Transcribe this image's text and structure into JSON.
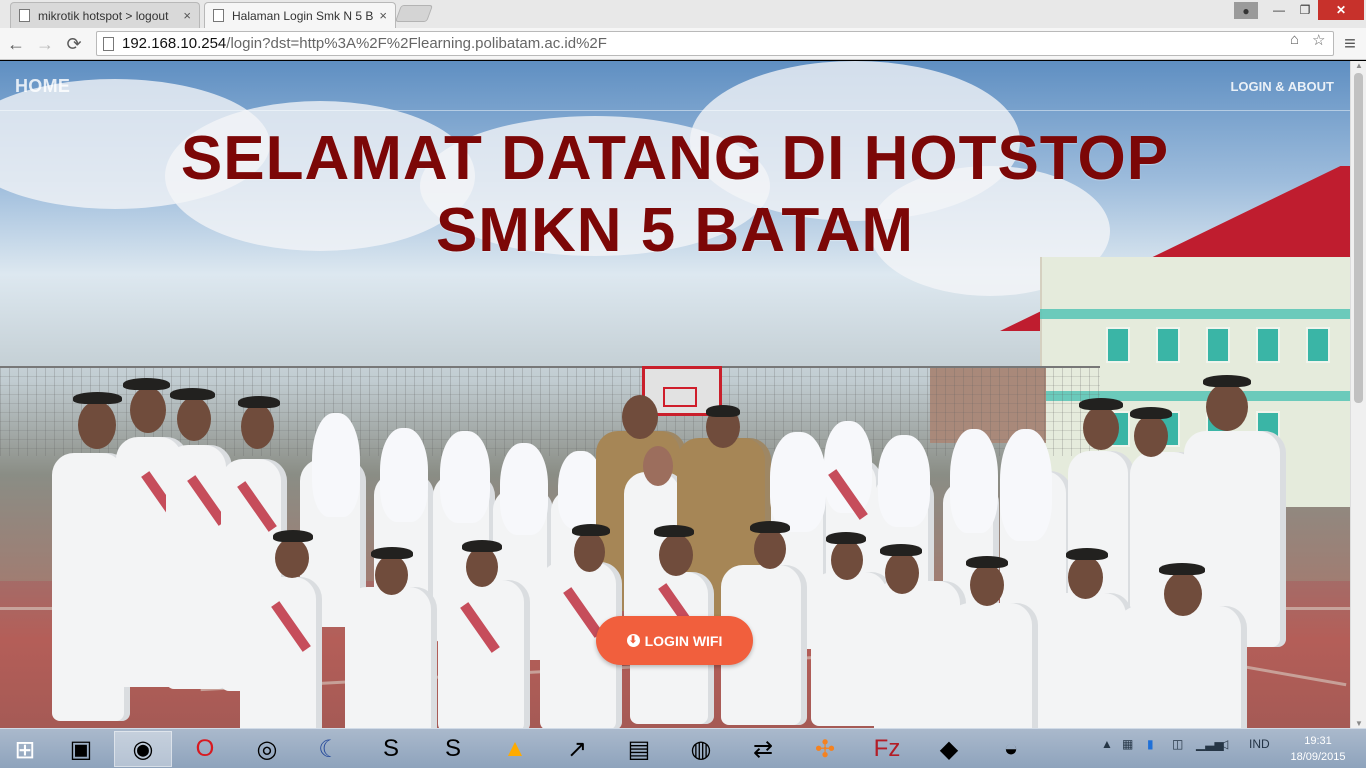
{
  "browser": {
    "tabs": [
      {
        "title": "mikrotik hotspot > logout"
      },
      {
        "title": "Halaman Login Smk N 5 B"
      }
    ],
    "address": {
      "host": "192.168.10.254",
      "path": "/login?dst=http%3A%2F%2Flearning.polibatam.ac.id%2F"
    }
  },
  "window": {
    "minimize": "—",
    "maximize": "❐",
    "close": "✕"
  },
  "page": {
    "nav": {
      "home": "HOME",
      "login_about": "LOGIN & ABOUT"
    },
    "heading": {
      "line1": "SELAMAT DATANG DI HOTSTOP",
      "line2": "SMKN 5 BATAM"
    },
    "login_button": "LOGIN WIFI"
  },
  "taskbar": {
    "language": "IND",
    "time": "19:31",
    "date": "18/09/2015"
  },
  "icons": {
    "close": "×",
    "person": "●",
    "back": "←",
    "forward": "→",
    "reload": "⟳",
    "translate": "⌂",
    "star": "☆",
    "menu": "≡",
    "download": "⬇",
    "scroll_up": "▲",
    "scroll_down": "▼",
    "start": "⊞",
    "folder": "▣",
    "chrome": "◉",
    "opera": "O",
    "globe": "◎",
    "moon": "☾",
    "sublime": "S",
    "warning": "▲",
    "chart": "↗",
    "desktop": "▤",
    "download_globe": "◍",
    "network": "⇄",
    "xampp": "✣",
    "filezilla": "Fz",
    "note": "◆",
    "palette": "◒",
    "tray_up": "▲",
    "action": "▦",
    "security": "▮",
    "network_status": "◫",
    "signal": "▁▃▅",
    "volume": "◁"
  }
}
